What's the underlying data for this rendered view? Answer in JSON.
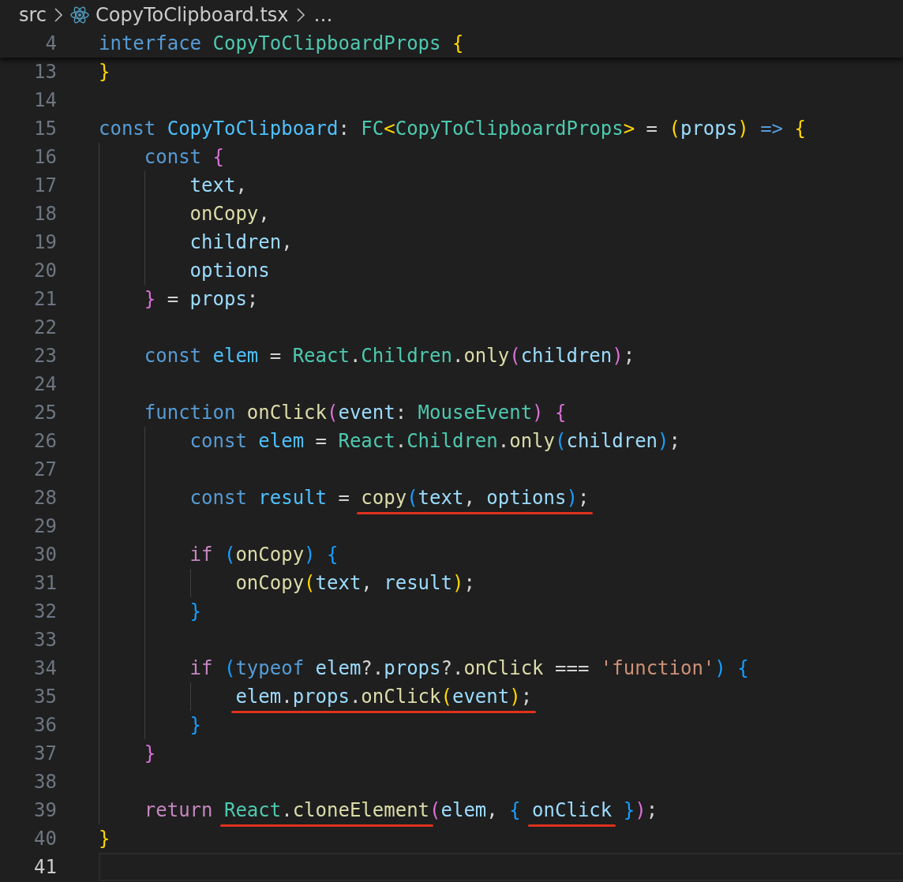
{
  "breadcrumb": [
    {
      "label": "src",
      "kind": "folder"
    },
    {
      "label": "CopyToClipboard.tsx",
      "kind": "react-file"
    },
    {
      "label": "…",
      "kind": "more"
    }
  ],
  "sticky_line": {
    "number": "4",
    "tokens": [
      {
        "text": "interface ",
        "kind": "kw"
      },
      {
        "text": "CopyToClipboardProps ",
        "kind": "type"
      },
      {
        "text": "{",
        "kind": "b1"
      }
    ]
  },
  "lines": [
    {
      "number": "13",
      "current": false,
      "tokens": [
        {
          "text": "}",
          "kind": "b1"
        }
      ]
    },
    {
      "number": "14",
      "current": false
    },
    {
      "number": "15",
      "current": false,
      "tokens": [
        {
          "text": "const ",
          "kind": "kw"
        },
        {
          "text": "CopyToClipboard",
          "kind": "const"
        },
        {
          "text": ": ",
          "kind": "p"
        },
        {
          "text": "FC",
          "kind": "type"
        },
        {
          "text": "<",
          "kind": "b1"
        },
        {
          "text": "CopyToClipboardProps",
          "kind": "type"
        },
        {
          "text": ">",
          "kind": "b1"
        },
        {
          "text": " = ",
          "kind": "p"
        },
        {
          "text": "(",
          "kind": "b1"
        },
        {
          "text": "props",
          "kind": "var"
        },
        {
          "text": ") ",
          "kind": "b1"
        },
        {
          "text": "=> ",
          "kind": "kw"
        },
        {
          "text": "{",
          "kind": "b1"
        }
      ]
    },
    {
      "number": "16",
      "current": false,
      "tokens": [
        {
          "text": "    const ",
          "kind": "kw"
        },
        {
          "text": "{",
          "kind": "b2"
        }
      ]
    },
    {
      "number": "17",
      "current": false,
      "tokens": [
        {
          "text": "        text",
          "kind": "var"
        },
        {
          "text": ",",
          "kind": "p"
        }
      ]
    },
    {
      "number": "18",
      "current": false,
      "tokens": [
        {
          "text": "        onCopy",
          "kind": "fn"
        },
        {
          "text": ",",
          "kind": "p"
        }
      ]
    },
    {
      "number": "19",
      "current": false,
      "tokens": [
        {
          "text": "        children",
          "kind": "var"
        },
        {
          "text": ",",
          "kind": "p"
        }
      ]
    },
    {
      "number": "20",
      "current": false,
      "tokens": [
        {
          "text": "        options",
          "kind": "var"
        }
      ]
    },
    {
      "number": "21",
      "current": false,
      "tokens": [
        {
          "text": "    }",
          "kind": "b2"
        },
        {
          "text": " = ",
          "kind": "p"
        },
        {
          "text": "props",
          "kind": "var"
        },
        {
          "text": ";",
          "kind": "p"
        }
      ]
    },
    {
      "number": "22",
      "current": false
    },
    {
      "number": "23",
      "current": false,
      "tokens": [
        {
          "text": "    const ",
          "kind": "kw"
        },
        {
          "text": "elem",
          "kind": "const"
        },
        {
          "text": " = ",
          "kind": "p"
        },
        {
          "text": "React",
          "kind": "type"
        },
        {
          "text": ".",
          "kind": "p"
        },
        {
          "text": "Children",
          "kind": "type"
        },
        {
          "text": ".",
          "kind": "p"
        },
        {
          "text": "only",
          "kind": "fn"
        },
        {
          "text": "(",
          "kind": "b2"
        },
        {
          "text": "children",
          "kind": "var"
        },
        {
          "text": ")",
          "kind": "b2"
        },
        {
          "text": ";",
          "kind": "p"
        }
      ]
    },
    {
      "number": "24",
      "current": false
    },
    {
      "number": "25",
      "current": false,
      "tokens": [
        {
          "text": "    function ",
          "kind": "kw"
        },
        {
          "text": "onClick",
          "kind": "fn"
        },
        {
          "text": "(",
          "kind": "b2"
        },
        {
          "text": "event",
          "kind": "var"
        },
        {
          "text": ": ",
          "kind": "p"
        },
        {
          "text": "MouseEvent",
          "kind": "type"
        },
        {
          "text": ") ",
          "kind": "b2"
        },
        {
          "text": "{",
          "kind": "b2"
        }
      ]
    },
    {
      "number": "26",
      "current": false,
      "tokens": [
        {
          "text": "        const ",
          "kind": "kw"
        },
        {
          "text": "elem",
          "kind": "const"
        },
        {
          "text": " = ",
          "kind": "p"
        },
        {
          "text": "React",
          "kind": "type"
        },
        {
          "text": ".",
          "kind": "p"
        },
        {
          "text": "Children",
          "kind": "type"
        },
        {
          "text": ".",
          "kind": "p"
        },
        {
          "text": "only",
          "kind": "fn"
        },
        {
          "text": "(",
          "kind": "b3"
        },
        {
          "text": "children",
          "kind": "var"
        },
        {
          "text": ")",
          "kind": "b3"
        },
        {
          "text": ";",
          "kind": "p"
        }
      ]
    },
    {
      "number": "27",
      "current": false
    },
    {
      "number": "28",
      "current": false,
      "tokens": [
        {
          "text": "        const ",
          "kind": "kw"
        },
        {
          "text": "result",
          "kind": "const"
        },
        {
          "text": " = ",
          "kind": "p"
        },
        {
          "underlined": true,
          "tokens": [
            {
              "text": "copy",
              "kind": "fn"
            },
            {
              "text": "(",
              "kind": "b3"
            },
            {
              "text": "text",
              "kind": "var"
            },
            {
              "text": ", ",
              "kind": "p"
            },
            {
              "text": "options",
              "kind": "var"
            },
            {
              "text": ")",
              "kind": "b3"
            },
            {
              "text": ";",
              "kind": "p"
            }
          ]
        }
      ]
    },
    {
      "number": "29",
      "current": false
    },
    {
      "number": "30",
      "current": false,
      "tokens": [
        {
          "text": "        if ",
          "kind": "ctl"
        },
        {
          "text": "(",
          "kind": "b3"
        },
        {
          "text": "onCopy",
          "kind": "fn"
        },
        {
          "text": ") ",
          "kind": "b3"
        },
        {
          "text": "{",
          "kind": "b3"
        }
      ]
    },
    {
      "number": "31",
      "current": false,
      "tokens": [
        {
          "text": "            onCopy",
          "kind": "fn"
        },
        {
          "text": "(",
          "kind": "b1"
        },
        {
          "text": "text",
          "kind": "var"
        },
        {
          "text": ", ",
          "kind": "p"
        },
        {
          "text": "result",
          "kind": "var"
        },
        {
          "text": ")",
          "kind": "b1"
        },
        {
          "text": ";",
          "kind": "p"
        }
      ]
    },
    {
      "number": "32",
      "current": false,
      "tokens": [
        {
          "text": "        }",
          "kind": "b3"
        }
      ]
    },
    {
      "number": "33",
      "current": false
    },
    {
      "number": "34",
      "current": false,
      "tokens": [
        {
          "text": "        if ",
          "kind": "ctl"
        },
        {
          "text": "(",
          "kind": "b3"
        },
        {
          "text": "typeof ",
          "kind": "kw"
        },
        {
          "text": "elem",
          "kind": "var"
        },
        {
          "text": "?.",
          "kind": "p"
        },
        {
          "text": "props",
          "kind": "var"
        },
        {
          "text": "?.",
          "kind": "p"
        },
        {
          "text": "onClick",
          "kind": "fn"
        },
        {
          "text": " === ",
          "kind": "p"
        },
        {
          "text": "'function'",
          "kind": "str"
        },
        {
          "text": ") ",
          "kind": "b3"
        },
        {
          "text": "{",
          "kind": "b3"
        }
      ]
    },
    {
      "number": "35",
      "current": false,
      "tokens": [
        {
          "underlined": true,
          "tokens": [
            {
              "text": "            elem",
              "kind": "var"
            },
            {
              "text": ".",
              "kind": "p"
            },
            {
              "text": "props",
              "kind": "var"
            },
            {
              "text": ".",
              "kind": "p"
            },
            {
              "text": "onClick",
              "kind": "fn"
            },
            {
              "text": "(",
              "kind": "b1"
            },
            {
              "text": "event",
              "kind": "var"
            },
            {
              "text": ")",
              "kind": "b1"
            },
            {
              "text": ";",
              "kind": "p"
            }
          ]
        }
      ]
    },
    {
      "number": "36",
      "current": false,
      "tokens": [
        {
          "text": "        }",
          "kind": "b3"
        }
      ]
    },
    {
      "number": "37",
      "current": false,
      "tokens": [
        {
          "text": "    }",
          "kind": "b2"
        }
      ]
    },
    {
      "number": "38",
      "current": false
    },
    {
      "number": "39",
      "current": false,
      "tokens": [
        {
          "text": "    return ",
          "kind": "ctl"
        },
        {
          "underlined": true,
          "tokens": [
            {
              "text": "React",
              "kind": "type"
            },
            {
              "text": ".",
              "kind": "p"
            },
            {
              "text": "cloneElement",
              "kind": "fn"
            }
          ]
        },
        {
          "text": "(",
          "kind": "b2"
        },
        {
          "text": "elem",
          "kind": "var"
        },
        {
          "text": ", ",
          "kind": "p"
        },
        {
          "text": "{ ",
          "kind": "b3"
        },
        {
          "underlined": true,
          "tokens": [
            {
              "text": "onClick",
              "kind": "var"
            }
          ]
        },
        {
          "text": " }",
          "kind": "b3"
        },
        {
          "text": ")",
          "kind": "b2"
        },
        {
          "text": ";",
          "kind": "p"
        }
      ]
    },
    {
      "number": "40",
      "current": false,
      "tokens": [
        {
          "text": "}",
          "kind": "b1"
        }
      ]
    },
    {
      "number": "41",
      "current": true
    }
  ]
}
